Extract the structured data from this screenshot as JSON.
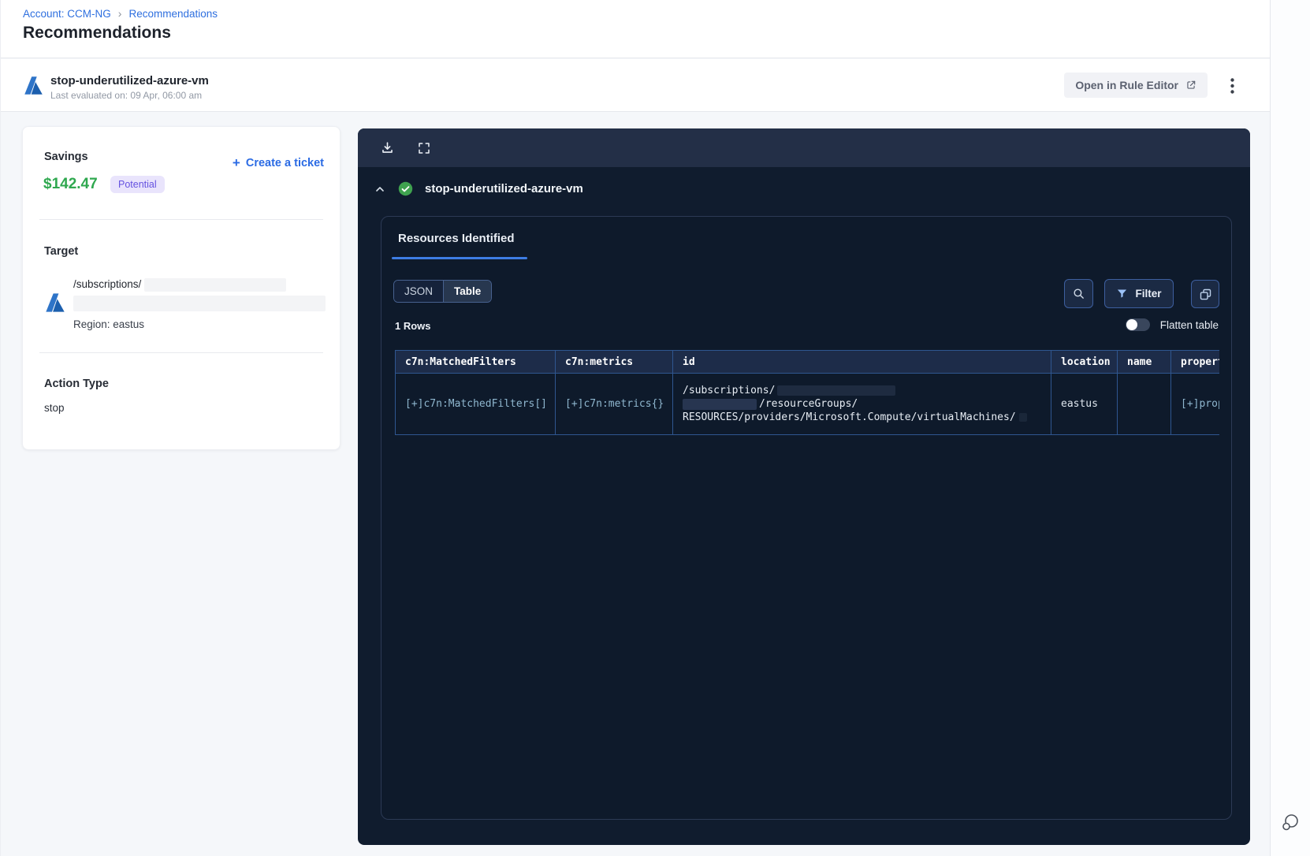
{
  "breadcrumb": {
    "account_link": "Account: CCM-NG",
    "separator": "›",
    "page_link": "Recommendations"
  },
  "page_title": "Recommendations",
  "header": {
    "name": "stop-underutilized-azure-vm",
    "last_evaluated": "Last evaluated on: 09 Apr, 06:00 am",
    "open_in_rule_editor": "Open in Rule Editor"
  },
  "savings_card": {
    "savings_label": "Savings",
    "plus": "+",
    "create_ticket_label": "Create a ticket",
    "amount": "$142.47",
    "badge": "Potential",
    "target_label": "Target",
    "target_path": "/subscriptions/",
    "region": "Region: eastus",
    "action_type_label": "Action Type",
    "action_type": "stop"
  },
  "viewer": {
    "resource_name": "stop-underutilized-azure-vm",
    "tab_label": "Resources Identified",
    "view_toggle": {
      "json_label": "JSON",
      "table_label": "Table",
      "selected": "Table"
    },
    "filter_label": "Filter",
    "row_count": "1 Rows",
    "flatten_label": "Flatten table",
    "flatten_on": false,
    "table": {
      "columns": [
        "c7n:MatchedFilters",
        "c7n:metrics",
        "id",
        "location",
        "name",
        "propert"
      ],
      "row": {
        "c7n_matched_filters": "[+]c7n:MatchedFilters[]",
        "c7n_metrics": "[+]c7n:metrics{}",
        "id_line_1": "/subscriptions/",
        "id_line_2": "/resourceGroups/",
        "id_line_3": "RESOURCES/providers/Microsoft.Compute/virtualMachines/",
        "location": "eastus",
        "name": "",
        "properties": "[+]prop"
      }
    }
  },
  "colors": {
    "accent_blue": "#2e6fdf",
    "savings_green": "#2fa84f",
    "badge_bg": "#e9e4fc",
    "badge_text": "#6552e0",
    "panel_bg": "#101c2e",
    "toolbar_bg": "#232f47",
    "table_border": "#2f5690",
    "cell_text_teal": "#8fb7cf",
    "tab_underline": "#3d7de4",
    "check_green": "#3fa24f"
  }
}
